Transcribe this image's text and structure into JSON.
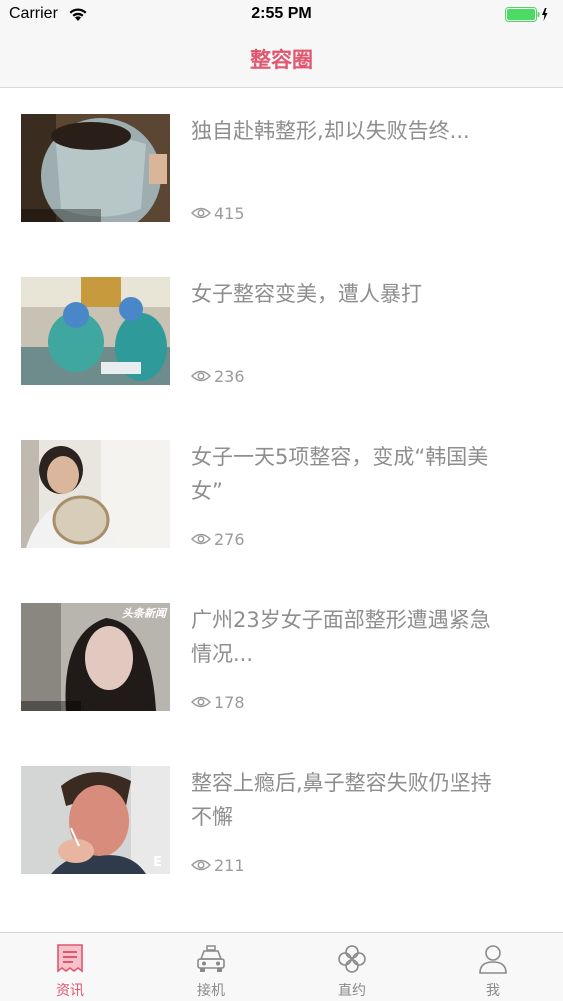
{
  "status_bar": {
    "carrier": "Carrier",
    "time": "2:55 PM"
  },
  "nav": {
    "title": "整容圈"
  },
  "news": [
    {
      "title": "独自赴韩整形,却以失败告终...",
      "views": "415",
      "thumb_overlay": ""
    },
    {
      "title": "女子整容变美，遭人暴打",
      "views": "236",
      "thumb_overlay": ""
    },
    {
      "title": "女子一天5项整容，变成“韩国美女”",
      "views": "276",
      "thumb_overlay": ""
    },
    {
      "title": "广州23岁女子面部整形遭遇紧急情况...",
      "views": "178",
      "thumb_overlay": "头条新闻"
    },
    {
      "title": "整容上瘾后,鼻子整容失败仍坚持不懈",
      "views": "211",
      "thumb_overlay": "E"
    }
  ],
  "tabs": [
    {
      "label": "资讯",
      "icon": "news-icon",
      "active": true
    },
    {
      "label": "接机",
      "icon": "car-icon",
      "active": false
    },
    {
      "label": "直约",
      "icon": "clover-icon",
      "active": false
    },
    {
      "label": "我",
      "icon": "person-icon",
      "active": false
    }
  ],
  "colors": {
    "accent": "#e0566f",
    "text_gray": "#8e8e8e",
    "battery": "#4cd964"
  }
}
